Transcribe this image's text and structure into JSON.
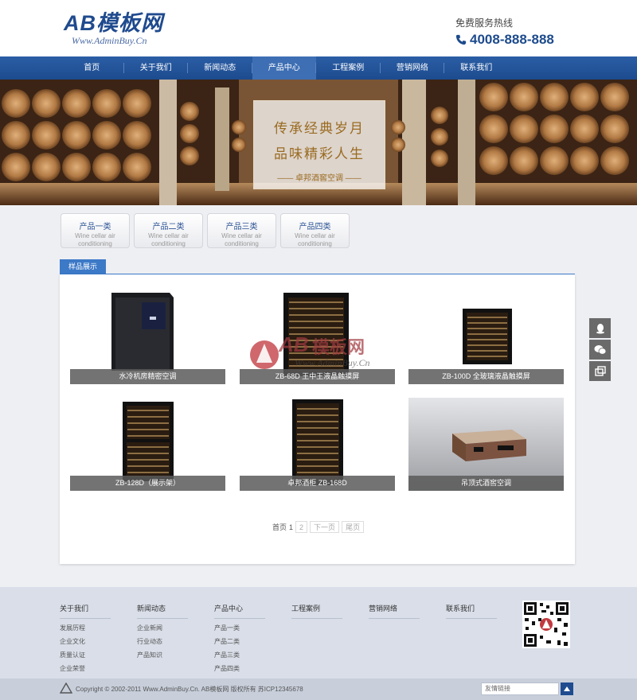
{
  "logo": {
    "main": "AB模板网",
    "sub": "Www.AdminBuy.Cn"
  },
  "hotline": {
    "label": "免费服务热线",
    "number": "4008-888-888"
  },
  "nav": [
    "首页",
    "关于我们",
    "新闻动态",
    "产品中心",
    "工程案例",
    "营销网络",
    "联系我们"
  ],
  "nav_active": "产品中心",
  "banner": {
    "line1": "传承经典岁月",
    "line2": "品味精彩人生",
    "line3": "—— 卓邦酒窖空调 ——"
  },
  "categories": [
    {
      "cn": "产品一类",
      "en1": "Wine cellar air",
      "en2": "conditioning"
    },
    {
      "cn": "产品二类",
      "en1": "Wine cellar air",
      "en2": "conditioning"
    },
    {
      "cn": "产品三类",
      "en1": "Wine cellar air",
      "en2": "conditioning"
    },
    {
      "cn": "产品四类",
      "en1": "Wine cellar air",
      "en2": "conditioning"
    }
  ],
  "section_title": "样品展示",
  "products": [
    {
      "caption": "水冷机房精密空调",
      "icon": "cabinet-ac-image"
    },
    {
      "caption": "ZB-68D 王中王液晶触摸屏",
      "icon": "wine-cabinet-image"
    },
    {
      "caption": "ZB-100D 全玻璃液晶触摸屏",
      "icon": "wine-cabinet-image"
    },
    {
      "caption": "ZB-128D（展示架）",
      "icon": "wine-cabinet-image"
    },
    {
      "caption": "卓邦酒柜 ZB-168D",
      "icon": "wine-cabinet-image"
    },
    {
      "caption": "吊顶式酒窖空调",
      "icon": "ceiling-ac-image"
    }
  ],
  "watermark": {
    "main": "AB模板网",
    "sub": "Www.AdminBuy.Cn"
  },
  "pager": {
    "first": "首页",
    "current": "1",
    "page2": "2",
    "next": "下一页",
    "last": "尾页"
  },
  "footer": {
    "columns": [
      {
        "title": "关于我们",
        "items": [
          "发展历程",
          "企业文化",
          "质量认证",
          "企业荣誉"
        ]
      },
      {
        "title": "新闻动态",
        "items": [
          "企业新闻",
          "行业动态",
          "产品知识"
        ]
      },
      {
        "title": "产品中心",
        "items": [
          "产品一类",
          "产品二类",
          "产品三类",
          "产品四类"
        ]
      },
      {
        "title": "工程案例",
        "items": []
      },
      {
        "title": "营销网络",
        "items": []
      },
      {
        "title": "联系我们",
        "items": []
      }
    ],
    "copyright": "Copyright © 2002-2011 Www.AdminBuy.Cn. AB模板网 版权所有 苏ICP12345678",
    "links_placeholder": "友情链接"
  },
  "colors": {
    "brand": "#1f4a8e",
    "nav": "#2b5ea6",
    "accent": "#3c79c7"
  }
}
